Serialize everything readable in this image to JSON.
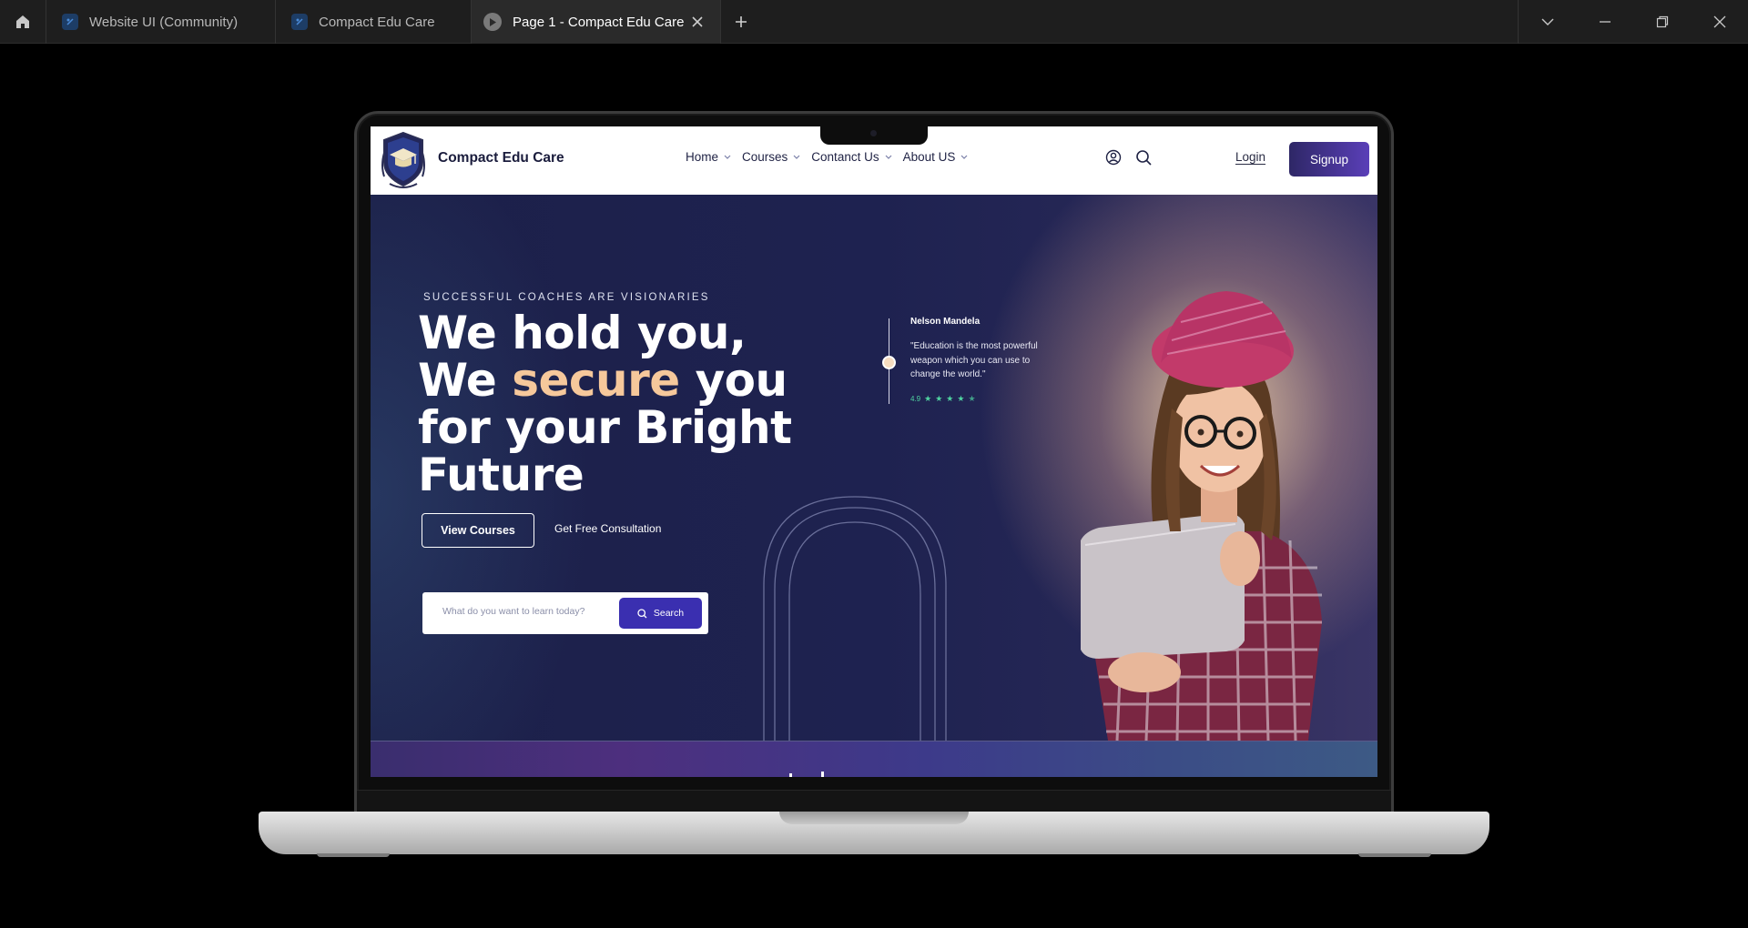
{
  "tabs": [
    {
      "label": "Website UI (Community)"
    },
    {
      "label": "Compact Edu Care"
    },
    {
      "label": "Page 1 - Compact Edu Care"
    }
  ],
  "site": {
    "brand": "Compact Edu Care",
    "nav": [
      "Home",
      "Courses",
      "Contanct Us",
      "About US"
    ],
    "login": "Login",
    "signup": "Signup"
  },
  "hero": {
    "eyebrow": "SUCCESSFUL COACHES ARE VISIONARIES",
    "headline_1": "We hold you,",
    "headline_2a": "We ",
    "headline_2b": "secure",
    "headline_2c": " you",
    "headline_3": "for your Bright",
    "headline_4": "Future",
    "btn_courses": "View Courses",
    "btn_consult": "Get Free Consultation",
    "search_placeholder": "What do you want to learn today?",
    "search_button": "Search",
    "accent_color": "#f6c89b"
  },
  "quote": {
    "author": "Nelson Mandela",
    "text": "\"Education is the most powerful weapon which you can use to change the world.\"",
    "rating": "4.9",
    "stars": 5
  },
  "icons": {
    "home": "home-icon",
    "tab_app": "figma-file-icon",
    "tab_play": "play-icon",
    "close": "close-icon",
    "new_tab": "plus-icon",
    "user": "user-circle-icon",
    "search": "search-icon"
  }
}
